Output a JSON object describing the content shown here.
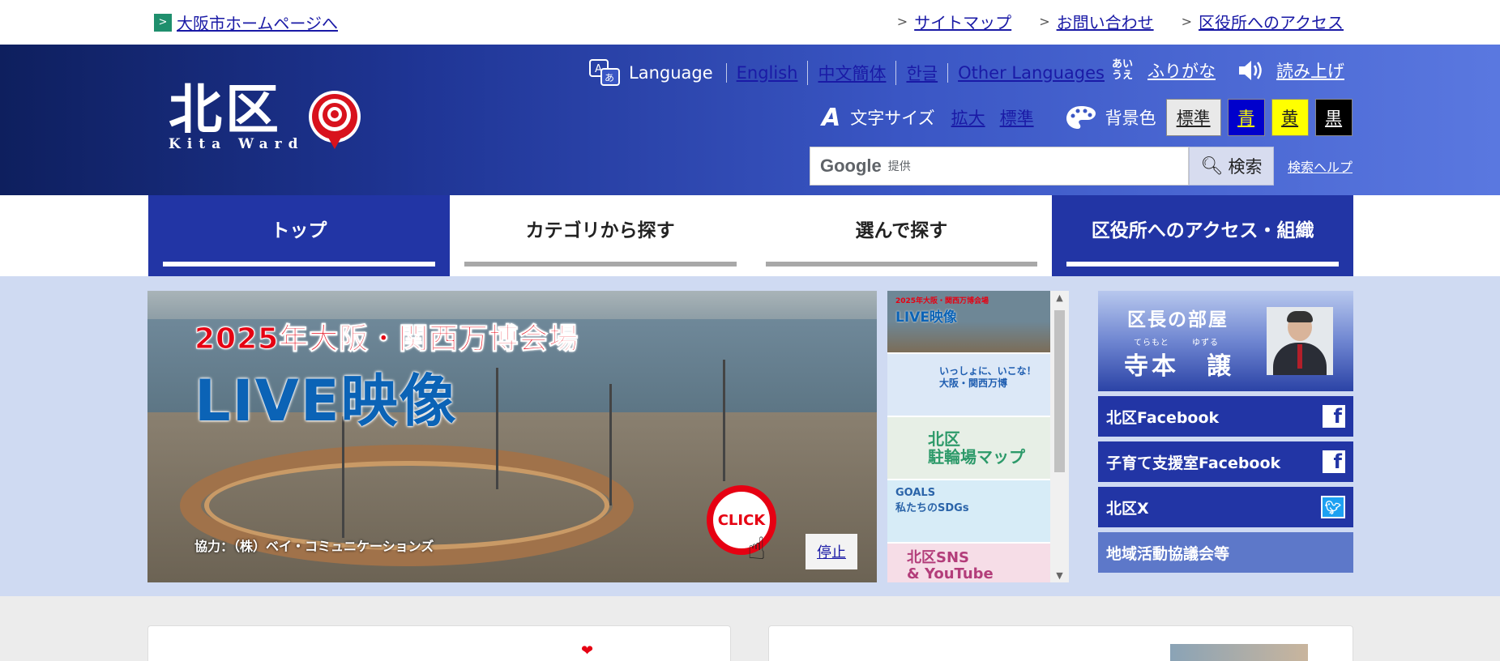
{
  "topbar": {
    "home_link": "大阪市ホームページへ",
    "links": [
      "サイトマップ",
      "お問い合わせ",
      "区役所へのアクセス"
    ]
  },
  "header": {
    "logo_kanji": "北区",
    "logo_roman": "Kita Ward",
    "language_label": "Language",
    "languages": [
      "English",
      "中文簡体",
      "한글",
      "Other Languages"
    ],
    "furigana_icon": "あいうえ",
    "furigana": "ふりがな",
    "read_aloud": "読み上げ",
    "text_size_label": "文字サイズ",
    "text_size_options": [
      "拡大",
      "標準"
    ],
    "bg_color_label": "背景色",
    "bg_options": [
      {
        "label": "標準",
        "bg": "#e9e9e9",
        "fg": "#222222"
      },
      {
        "label": "青",
        "bg": "#0000cc",
        "fg": "#ffff00"
      },
      {
        "label": "黄",
        "bg": "#ffff00",
        "fg": "#222222"
      },
      {
        "label": "黒",
        "bg": "#000000",
        "fg": "#ffffff"
      }
    ],
    "search_google": "Google",
    "search_provider": "提供",
    "search_button": "検索",
    "search_help": "検索ヘルプ"
  },
  "nav": {
    "items": [
      "トップ",
      "カテゴリから探す",
      "選んで探す",
      "区役所へのアクセス・組織"
    ]
  },
  "slider": {
    "headline": "2025年大阪・関西万博会場",
    "subheadline": "LIVE映像",
    "credit": "協力：（株）ベイ・コミュニケーションズ",
    "click_label": "CLICK",
    "stop_button": "停止"
  },
  "thumbnails": [
    {
      "line1": "2025年大阪・関西万博会場",
      "line2": "LIVE映像"
    },
    {
      "line1": "いっしょに、いこな！",
      "line2": "大阪・関西万博"
    },
    {
      "line1": "北区",
      "line2": "駐輪場マップ"
    },
    {
      "line1": "GOALS",
      "line2": "私たちのSDGs"
    },
    {
      "line1": "北区SNS",
      "line2": "& YouTube"
    }
  ],
  "sidebar": {
    "mayor_title": "区長の部屋",
    "mayor_ruby_1": "てらもと",
    "mayor_ruby_2": "ゆずる",
    "mayor_name": "寺本　譲",
    "links": [
      {
        "label": "北区Facebook",
        "icon": "facebook-icon"
      },
      {
        "label": "子育て支援室Facebook",
        "icon": "facebook-icon"
      },
      {
        "label": "北区X",
        "icon": "twitter-icon"
      },
      {
        "label": "地域活動協議会等",
        "icon": ""
      }
    ]
  },
  "colors": {
    "header_start": "#0e1f5e",
    "header_end": "#5a78e0",
    "nav_dark": "#2235a5",
    "band": "#cfdaf2"
  }
}
